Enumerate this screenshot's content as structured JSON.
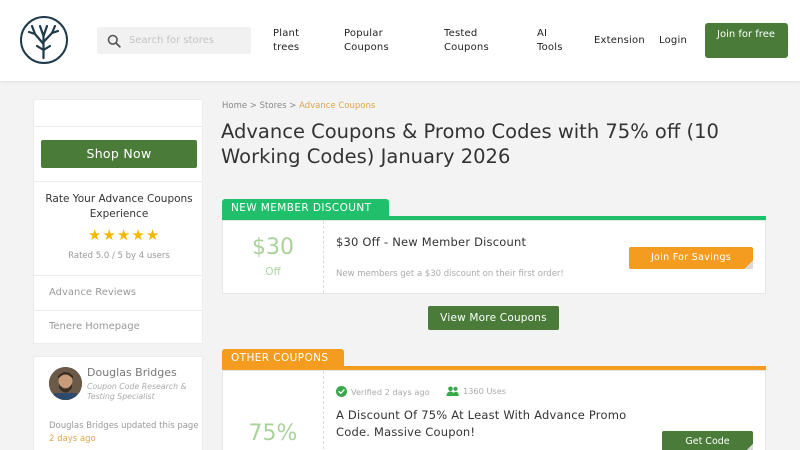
{
  "header": {
    "search_placeholder": "Search for stores",
    "nav": [
      {
        "label": "Plant trees"
      },
      {
        "label": "Popular Coupons"
      },
      {
        "label": "Tested Coupons"
      },
      {
        "label": "AI Tools"
      },
      {
        "label": "Extension"
      },
      {
        "label": "Login"
      }
    ],
    "join_label": "Join for free"
  },
  "sidebar": {
    "shop_label": "Shop Now",
    "rate_title": "Rate Your Advance Coupons Experience",
    "rated_text": "Rated 5.0 / 5 by 4 users",
    "stars": 5,
    "links": [
      "Advance Reviews",
      "Tenere Homepage"
    ],
    "author": {
      "name": "Douglas Bridges",
      "role": "Coupon Code Research & Testing Specialist",
      "updated_prefix": "Douglas Bridges updated this page",
      "updated_ago": "2 days ago"
    }
  },
  "breadcrumb": {
    "home": "Home",
    "stores": "Stores",
    "current": "Advance Coupons"
  },
  "page_title": "Advance Coupons & Promo Codes with 75% off (10 Working Codes) January 2026",
  "sections": {
    "new_member": {
      "tab_label": "NEW MEMBER DISCOUNT",
      "color": "#1fbf6b",
      "coupon": {
        "amount": "$30",
        "amount_sub": "Off",
        "title": "$30 Off - New Member Discount",
        "description": "New members get a $30 discount on their first order!",
        "button_label": "Join For Savings"
      }
    },
    "view_more_label": "View More Coupons",
    "other": {
      "tab_label": "OTHER COUPONS",
      "color": "#f39c1f",
      "coupon": {
        "amount": "75%",
        "verified": "Verified 2 days ago",
        "uses": "1360 Uses",
        "title": "A Discount Of 75% At Least With Advance Promo Code. Massive Coupon!",
        "button_label": "Get Code"
      }
    }
  },
  "colors": {
    "brand_green": "#4a7b38",
    "accent_orange": "#f39c1f",
    "teal": "#1fbf6b"
  }
}
